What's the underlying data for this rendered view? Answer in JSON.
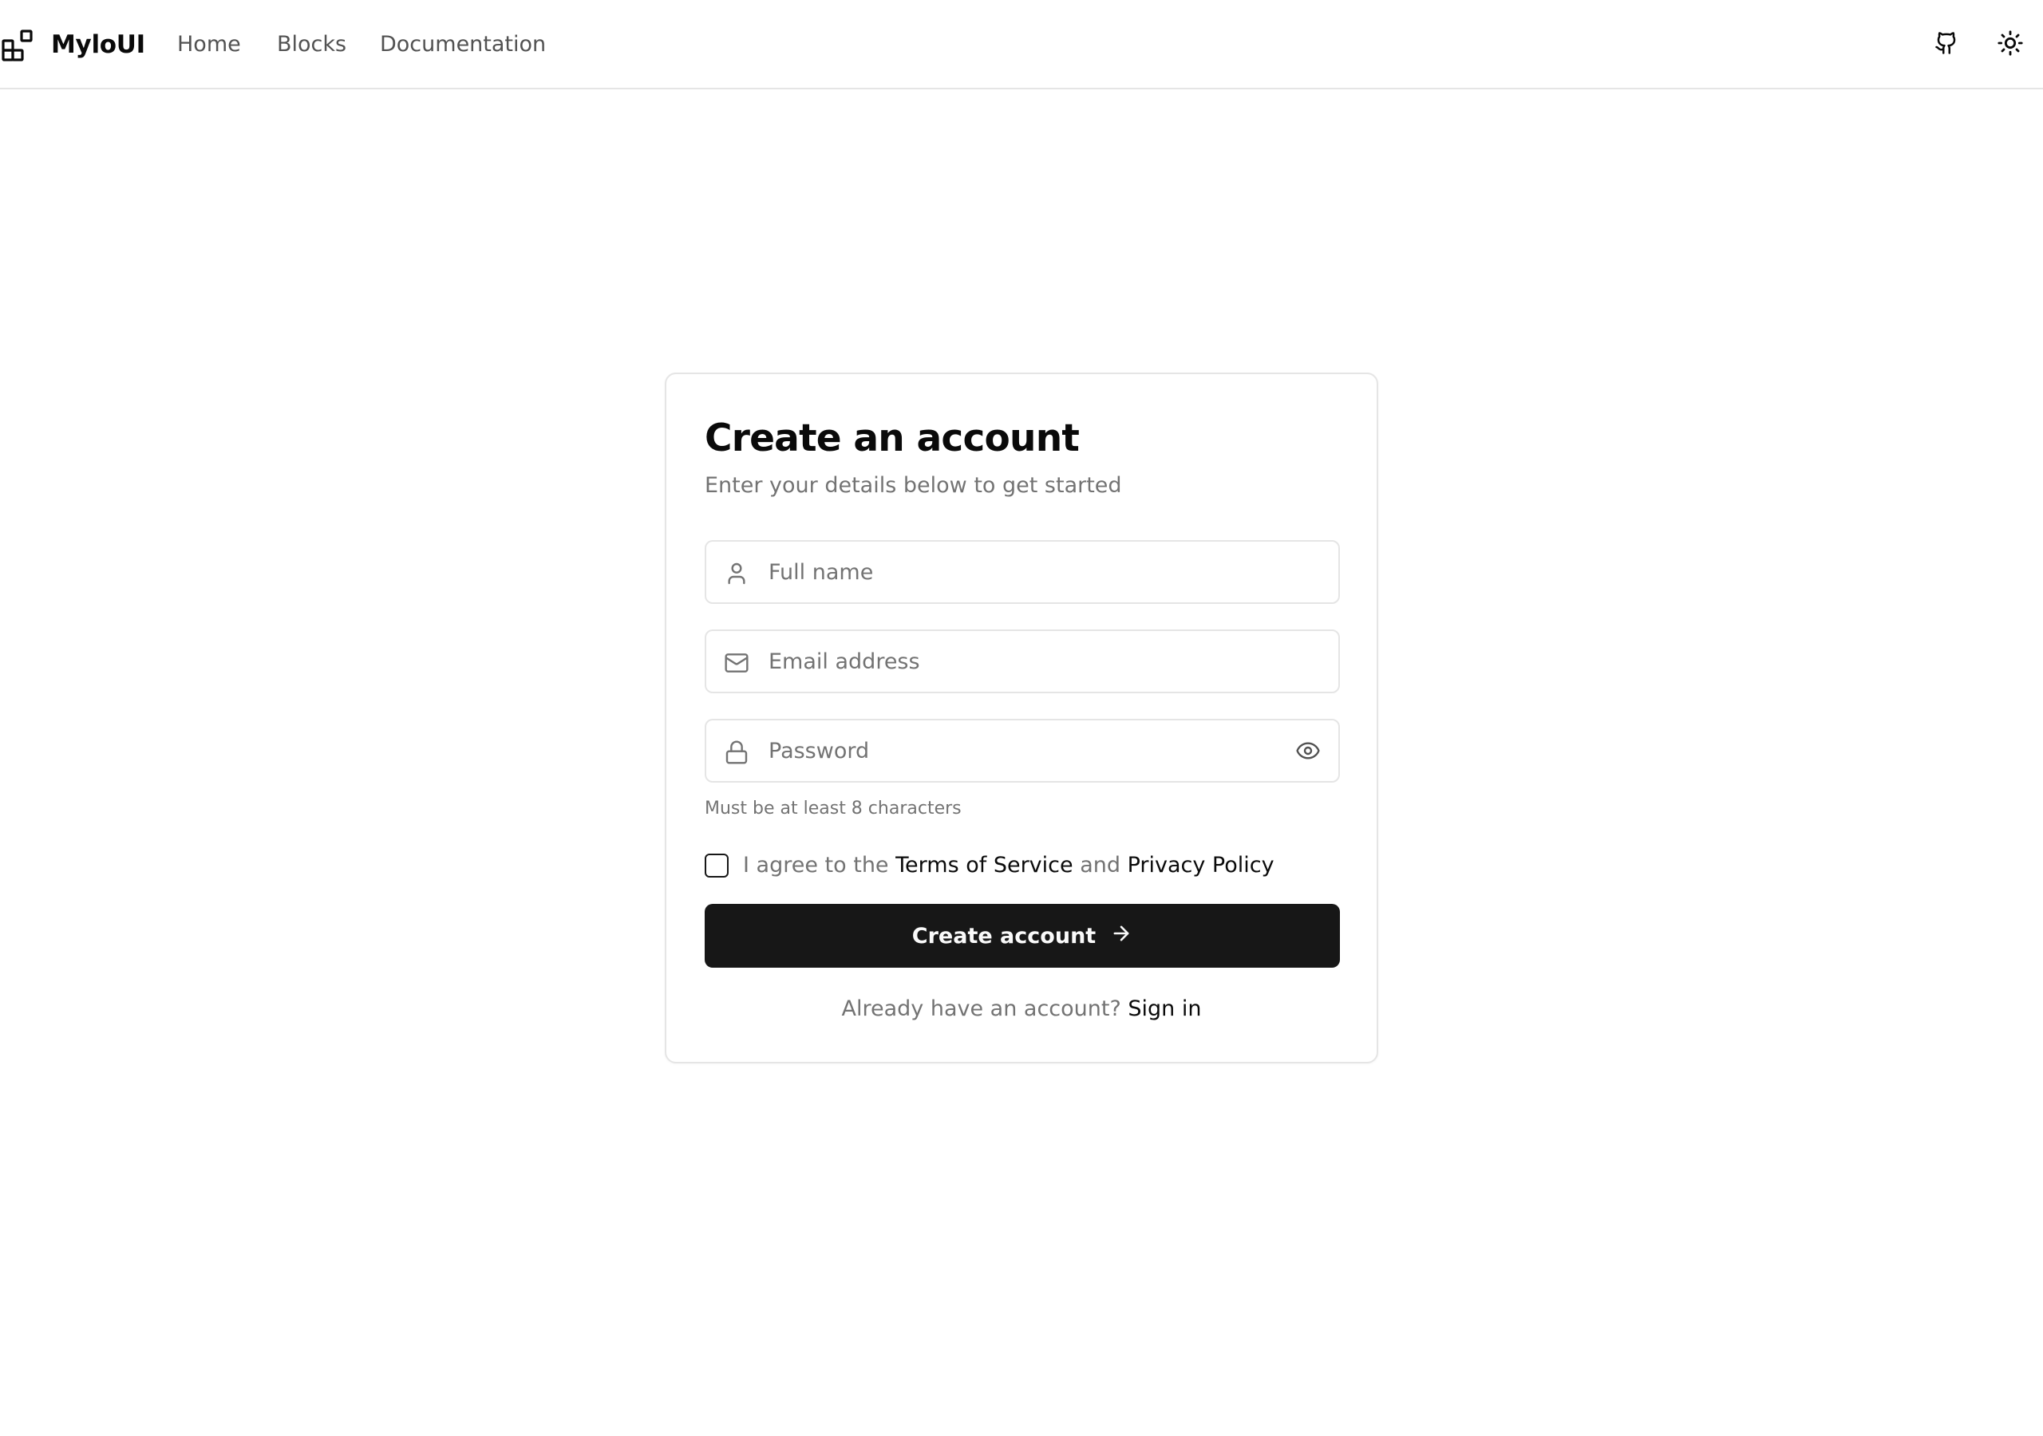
{
  "header": {
    "brand": "MyloUI",
    "nav": {
      "home": "Home",
      "blocks": "Blocks",
      "documentation": "Documentation"
    },
    "icons": {
      "logo": "blocks-logo-icon",
      "github": "github-icon",
      "theme": "sun-icon"
    }
  },
  "form": {
    "title": "Create an account",
    "subtitle": "Enter your details below to get started",
    "full_name": {
      "placeholder": "Full name",
      "value": "",
      "icon": "user-icon"
    },
    "email": {
      "placeholder": "Email address",
      "value": "",
      "icon": "mail-icon"
    },
    "password": {
      "placeholder": "Password",
      "value": "",
      "icon": "lock-icon",
      "toggle_icon": "eye-icon"
    },
    "password_hint": "Must be at least 8 characters",
    "terms": {
      "checked": false,
      "prefix": "I agree to the ",
      "terms_link": "Terms of Service",
      "conjunction": " and ",
      "privacy_link": "Privacy Policy"
    },
    "submit_label": "Create account",
    "submit_icon": "arrow-right-icon",
    "signin_prompt": "Already have an account? ",
    "signin_link": "Sign in"
  },
  "colors": {
    "primary": "#171717",
    "muted_text": "#737373",
    "border": "#e5e5e5",
    "background": "#ffffff"
  }
}
